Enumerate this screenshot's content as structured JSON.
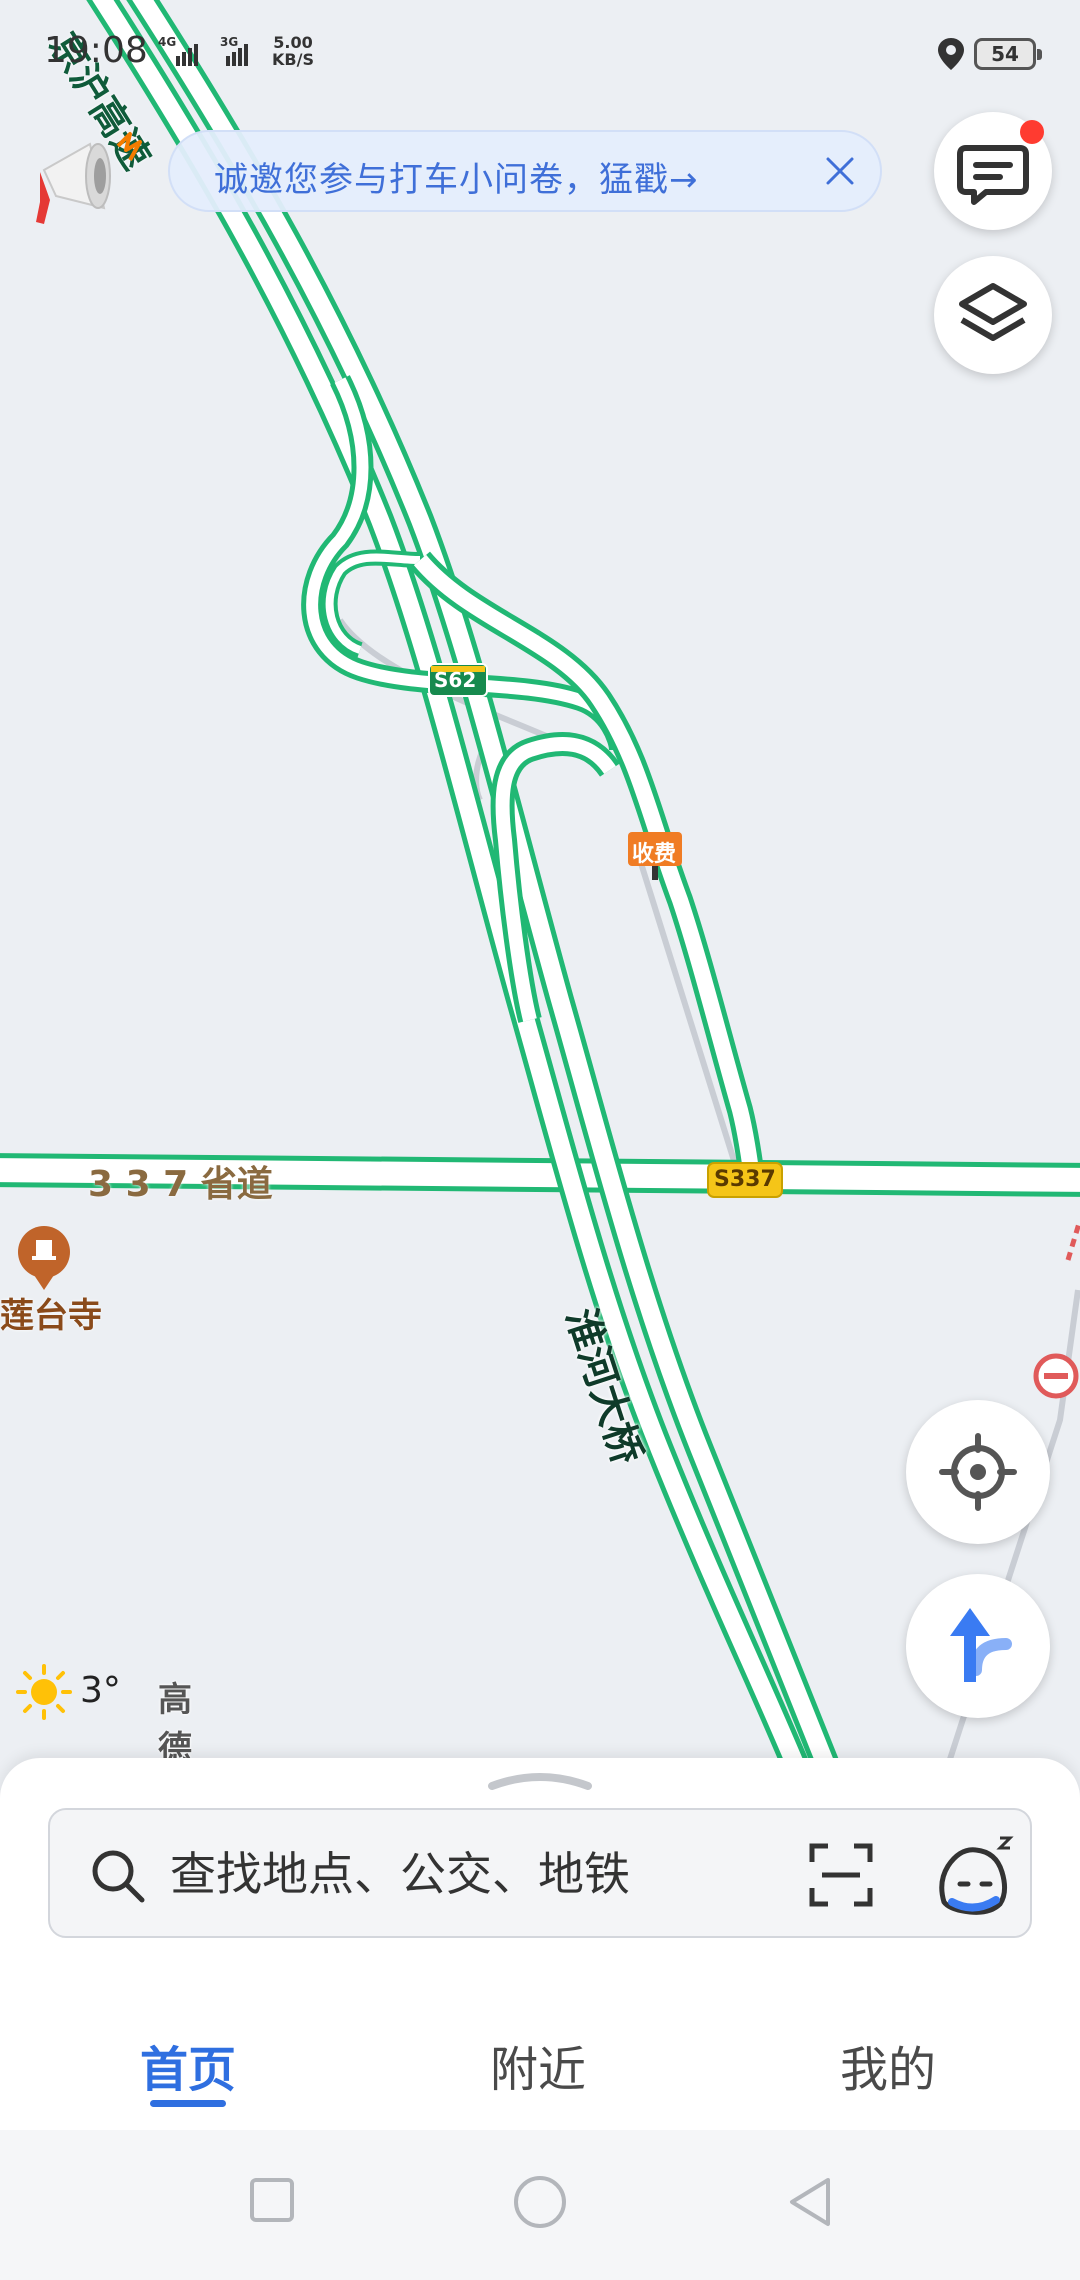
{
  "status_bar": {
    "time": "19:08",
    "network_1": "4G",
    "network_2": "3G",
    "speed_value": "5.00",
    "speed_unit": "KB/S",
    "battery": "54"
  },
  "banner": {
    "text": "诚邀您参与打车小问卷，猛戳→",
    "close_icon": "close-icon"
  },
  "map": {
    "top_road_label": "京沪高速",
    "s62_shield": "S62",
    "toll_label": "收费",
    "road_337_label": "3 3 7 省道",
    "s337_shield": "S337",
    "bridge_label": "淮河大桥",
    "poi_temple": "莲台寺",
    "colors": {
      "road_stroke": "#21b874",
      "road_fill": "#ffffff",
      "shield_green": "#178a4e",
      "shield_yellow": "#f5c518",
      "poi_brown": "#c0642a",
      "toll_orange": "#f07c24"
    }
  },
  "weather": {
    "temperature": "3°",
    "brand": "高德地图",
    "icon": "sun-icon"
  },
  "search": {
    "placeholder": "查找地点、公交、地铁"
  },
  "tabs": [
    {
      "label": "首页",
      "active": true
    },
    {
      "label": "附近",
      "active": false
    },
    {
      "label": "我的",
      "active": false
    }
  ],
  "accent_color": "#2f6fe0"
}
